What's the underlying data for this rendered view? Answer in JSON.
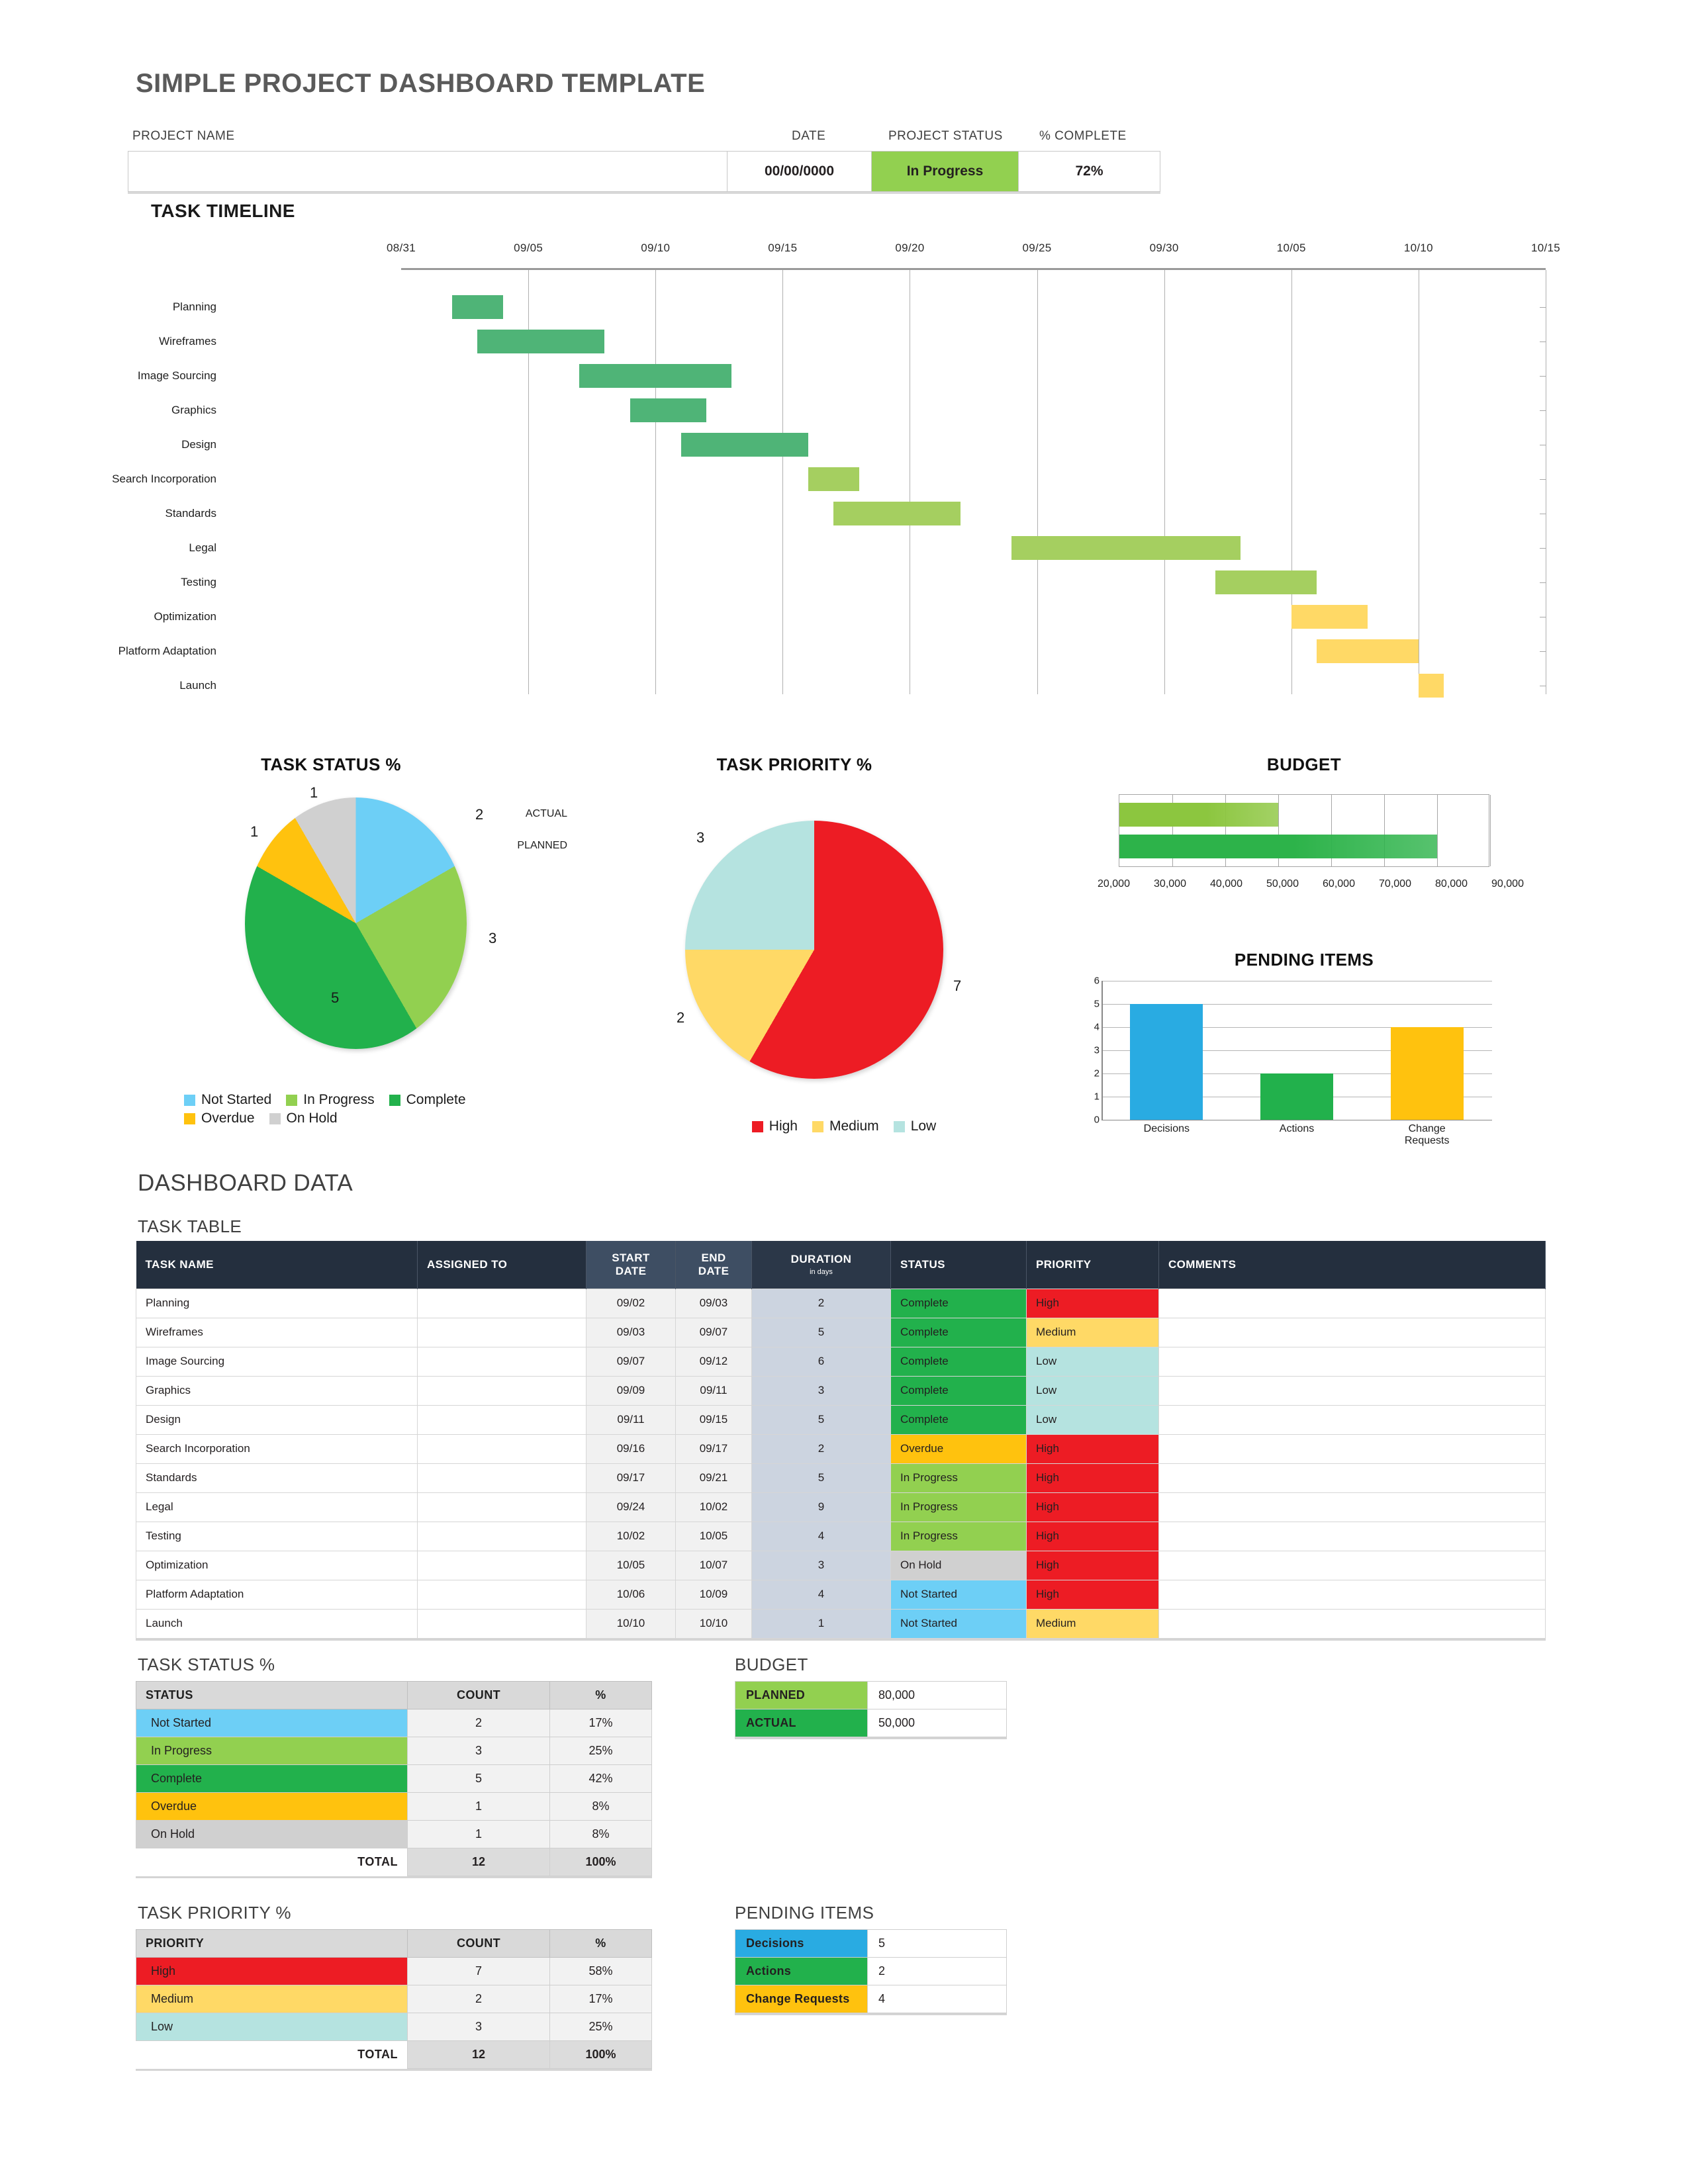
{
  "header": {
    "title": "SIMPLE PROJECT DASHBOARD TEMPLATE",
    "label_project_name": "PROJECT NAME",
    "label_date": "DATE",
    "label_project_status": "PROJECT  STATUS",
    "label_pct_complete": "% COMPLETE",
    "project_name_value": "",
    "date_value": "00/00/0000",
    "status_value": "In Progress",
    "pct_value": "72%",
    "status_color": "#92d050"
  },
  "sections": {
    "task_timeline": "TASK TIMELINE",
    "dashboard_data": "DASHBOARD DATA",
    "task_table": "TASK TABLE",
    "task_status_pct": "TASK STATUS %",
    "task_priority_pct": "TASK PRIORITY %",
    "budget": "BUDGET",
    "pending_items": "PENDING ITEMS"
  },
  "colors": {
    "not_started": "#6dcff6",
    "in_progress": "#92d050",
    "complete": "#22b14c",
    "overdue": "#ffc20e",
    "on_hold": "#d0d0d0",
    "high": "#ed1c24",
    "medium": "#ffd966",
    "low": "#b5e3e0",
    "gantt_green": "#4fb477",
    "gantt_light": "#a5cf60",
    "gantt_yellow": "#ffd966",
    "budget_planned": "#2db34a",
    "budget_actual": "#8cc63f",
    "decisions": "#29abe2",
    "actions": "#22b14c",
    "change_requests": "#ffc20e",
    "header_dark": "#242f3e"
  },
  "chart_data": [
    {
      "type": "bar",
      "name": "task-timeline-gantt",
      "title": "TASK TIMELINE",
      "orientation": "horizontal-gantt",
      "xlabel": "",
      "ylabel": "",
      "xticks": [
        "08/31",
        "09/05",
        "09/10",
        "09/15",
        "09/20",
        "09/25",
        "09/30",
        "10/05",
        "10/10",
        "10/15"
      ],
      "xlim": [
        "08/31",
        "10/15"
      ],
      "grid": true,
      "categories": [
        "Planning",
        "Wireframes",
        "Image Sourcing",
        "Graphics",
        "Design",
        "Search Incorporation",
        "Standards",
        "Legal",
        "Testing",
        "Optimization",
        "Platform Adaptation",
        "Launch"
      ],
      "bars": [
        {
          "task": "Planning",
          "start": "09/02",
          "end": "09/03",
          "duration": 2,
          "color": "#4fb477"
        },
        {
          "task": "Wireframes",
          "start": "09/03",
          "end": "09/07",
          "duration": 5,
          "color": "#4fb477"
        },
        {
          "task": "Image Sourcing",
          "start": "09/07",
          "end": "09/12",
          "duration": 6,
          "color": "#4fb477"
        },
        {
          "task": "Graphics",
          "start": "09/09",
          "end": "09/11",
          "duration": 3,
          "color": "#4fb477"
        },
        {
          "task": "Design",
          "start": "09/11",
          "end": "09/15",
          "duration": 5,
          "color": "#4fb477"
        },
        {
          "task": "Search Incorporation",
          "start": "09/16",
          "end": "09/17",
          "duration": 2,
          "color": "#a5cf60"
        },
        {
          "task": "Standards",
          "start": "09/17",
          "end": "09/21",
          "duration": 5,
          "color": "#a5cf60"
        },
        {
          "task": "Legal",
          "start": "09/24",
          "end": "10/02",
          "duration": 9,
          "color": "#a5cf60"
        },
        {
          "task": "Testing",
          "start": "10/02",
          "end": "10/05",
          "duration": 4,
          "color": "#a5cf60"
        },
        {
          "task": "Optimization",
          "start": "10/05",
          "end": "10/07",
          "duration": 3,
          "color": "#ffd966"
        },
        {
          "task": "Platform Adaptation",
          "start": "10/06",
          "end": "10/09",
          "duration": 4,
          "color": "#ffd966"
        },
        {
          "task": "Launch",
          "start": "10/10",
          "end": "10/10",
          "duration": 1,
          "color": "#ffd966"
        }
      ]
    },
    {
      "type": "pie",
      "name": "task-status-pie",
      "title": "TASK STATUS %",
      "labels": [
        "Not Started",
        "In Progress",
        "Complete",
        "Overdue",
        "On Hold"
      ],
      "values": [
        2,
        3,
        5,
        1,
        1
      ],
      "colors": [
        "#6dcff6",
        "#92d050",
        "#22b14c",
        "#ffc20e",
        "#d0d0d0"
      ],
      "data_labels": [
        "2",
        "3",
        "5",
        "1",
        "1"
      ],
      "legend_position": "bottom",
      "total": 12
    },
    {
      "type": "pie",
      "name": "task-priority-pie",
      "title": "TASK PRIORITY %",
      "labels": [
        "High",
        "Medium",
        "Low"
      ],
      "values": [
        7,
        2,
        3
      ],
      "colors": [
        "#ed1c24",
        "#ffd966",
        "#b5e3e0"
      ],
      "data_labels": [
        "7",
        "2",
        "3"
      ],
      "legend_position": "bottom",
      "total": 12
    },
    {
      "type": "bar",
      "name": "budget-bar",
      "title": "BUDGET",
      "orientation": "horizontal",
      "categories": [
        "ACTUAL",
        "PLANNED"
      ],
      "values": [
        50000,
        80000
      ],
      "colors": [
        "#8cc63f",
        "#2db34a"
      ],
      "xticks": [
        "20,000",
        "30,000",
        "40,000",
        "50,000",
        "60,000",
        "70,000",
        "80,000",
        "90,000"
      ],
      "xlim": [
        20000,
        90000
      ],
      "grid": true,
      "xlabel": "",
      "ylabel": ""
    },
    {
      "type": "bar",
      "name": "pending-items-bar",
      "title": "PENDING ITEMS",
      "orientation": "vertical",
      "categories": [
        "Decisions",
        "Actions",
        "Change Requests"
      ],
      "values": [
        5,
        2,
        4
      ],
      "colors": [
        "#29abe2",
        "#22b14c",
        "#ffc20e"
      ],
      "yticks": [
        "0",
        "1",
        "2",
        "3",
        "4",
        "5",
        "6"
      ],
      "ylim": [
        0,
        6
      ],
      "grid": true,
      "xlabel": "",
      "ylabel": ""
    }
  ],
  "legends": {
    "status": [
      {
        "label": "Not Started",
        "color": "#6dcff6"
      },
      {
        "label": "In Progress",
        "color": "#92d050"
      },
      {
        "label": "Complete",
        "color": "#22b14c"
      },
      {
        "label": "Overdue",
        "color": "#ffc20e"
      },
      {
        "label": "On Hold",
        "color": "#d0d0d0"
      }
    ],
    "priority": [
      {
        "label": "High",
        "color": "#ed1c24"
      },
      {
        "label": "Medium",
        "color": "#ffd966"
      },
      {
        "label": "Low",
        "color": "#b5e3e0"
      }
    ]
  },
  "task_table": {
    "headers": {
      "task_name": "TASK NAME",
      "assigned_to": "ASSIGNED TO",
      "start_date": "START DATE",
      "end_date": "END DATE",
      "duration": "DURATION",
      "duration_sub": "in days",
      "status": "STATUS",
      "priority": "PRIORITY",
      "comments": "COMMENTS"
    },
    "rows": [
      {
        "task": "Planning",
        "assigned": "",
        "start": "09/02",
        "end": "09/03",
        "duration": "2",
        "status": "Complete",
        "status_color": "#22b14c",
        "priority": "High",
        "priority_color": "#ed1c24",
        "comments": ""
      },
      {
        "task": "Wireframes",
        "assigned": "",
        "start": "09/03",
        "end": "09/07",
        "duration": "5",
        "status": "Complete",
        "status_color": "#22b14c",
        "priority": "Medium",
        "priority_color": "#ffd966",
        "comments": ""
      },
      {
        "task": "Image Sourcing",
        "assigned": "",
        "start": "09/07",
        "end": "09/12",
        "duration": "6",
        "status": "Complete",
        "status_color": "#22b14c",
        "priority": "Low",
        "priority_color": "#b5e3e0",
        "comments": ""
      },
      {
        "task": "Graphics",
        "assigned": "",
        "start": "09/09",
        "end": "09/11",
        "duration": "3",
        "status": "Complete",
        "status_color": "#22b14c",
        "priority": "Low",
        "priority_color": "#b5e3e0",
        "comments": ""
      },
      {
        "task": "Design",
        "assigned": "",
        "start": "09/11",
        "end": "09/15",
        "duration": "5",
        "status": "Complete",
        "status_color": "#22b14c",
        "priority": "Low",
        "priority_color": "#b5e3e0",
        "comments": ""
      },
      {
        "task": "Search Incorporation",
        "assigned": "",
        "start": "09/16",
        "end": "09/17",
        "duration": "2",
        "status": "Overdue",
        "status_color": "#ffc20e",
        "priority": "High",
        "priority_color": "#ed1c24",
        "comments": ""
      },
      {
        "task": "Standards",
        "assigned": "",
        "start": "09/17",
        "end": "09/21",
        "duration": "5",
        "status": "In Progress",
        "status_color": "#92d050",
        "priority": "High",
        "priority_color": "#ed1c24",
        "comments": ""
      },
      {
        "task": "Legal",
        "assigned": "",
        "start": "09/24",
        "end": "10/02",
        "duration": "9",
        "status": "In Progress",
        "status_color": "#92d050",
        "priority": "High",
        "priority_color": "#ed1c24",
        "comments": ""
      },
      {
        "task": "Testing",
        "assigned": "",
        "start": "10/02",
        "end": "10/05",
        "duration": "4",
        "status": "In Progress",
        "status_color": "#92d050",
        "priority": "High",
        "priority_color": "#ed1c24",
        "comments": ""
      },
      {
        "task": "Optimization",
        "assigned": "",
        "start": "10/05",
        "end": "10/07",
        "duration": "3",
        "status": "On Hold",
        "status_color": "#d0d0d0",
        "priority": "High",
        "priority_color": "#ed1c24",
        "comments": ""
      },
      {
        "task": "Platform Adaptation",
        "assigned": "",
        "start": "10/06",
        "end": "10/09",
        "duration": "4",
        "status": "Not Started",
        "status_color": "#6dcff6",
        "priority": "High",
        "priority_color": "#ed1c24",
        "comments": ""
      },
      {
        "task": "Launch",
        "assigned": "",
        "start": "10/10",
        "end": "10/10",
        "duration": "1",
        "status": "Not Started",
        "status_color": "#6dcff6",
        "priority": "Medium",
        "priority_color": "#ffd966",
        "comments": ""
      }
    ]
  },
  "status_summary": {
    "headers": [
      "STATUS",
      "COUNT",
      "%"
    ],
    "rows": [
      {
        "label": "Not Started",
        "count": "2",
        "pct": "17%",
        "color": "#6dcff6"
      },
      {
        "label": "In Progress",
        "count": "3",
        "pct": "25%",
        "color": "#92d050"
      },
      {
        "label": "Complete",
        "count": "5",
        "pct": "42%",
        "color": "#22b14c"
      },
      {
        "label": "Overdue",
        "count": "1",
        "pct": "8%",
        "color": "#ffc20e"
      },
      {
        "label": "On Hold",
        "count": "1",
        "pct": "8%",
        "color": "#d0d0d0"
      }
    ],
    "total_label": "TOTAL",
    "total_count": "12",
    "total_pct": "100%"
  },
  "priority_summary": {
    "headers": [
      "PRIORITY",
      "COUNT",
      "%"
    ],
    "rows": [
      {
        "label": "High",
        "count": "7",
        "pct": "58%",
        "color": "#ed1c24"
      },
      {
        "label": "Medium",
        "count": "2",
        "pct": "17%",
        "color": "#ffd966"
      },
      {
        "label": "Low",
        "count": "3",
        "pct": "25%",
        "color": "#b5e3e0"
      }
    ],
    "total_label": "TOTAL",
    "total_count": "12",
    "total_pct": "100%"
  },
  "budget_table": {
    "rows": [
      {
        "label": "PLANNED",
        "value": "80,000",
        "color": "#92d050"
      },
      {
        "label": "ACTUAL",
        "value": "50,000",
        "color": "#22b14c"
      }
    ]
  },
  "pending_table": {
    "rows": [
      {
        "label": "Decisions",
        "value": "5",
        "color": "#29abe2"
      },
      {
        "label": "Actions",
        "value": "2",
        "color": "#22b14c"
      },
      {
        "label": "Change Requests",
        "value": "4",
        "color": "#ffc20e"
      }
    ]
  }
}
